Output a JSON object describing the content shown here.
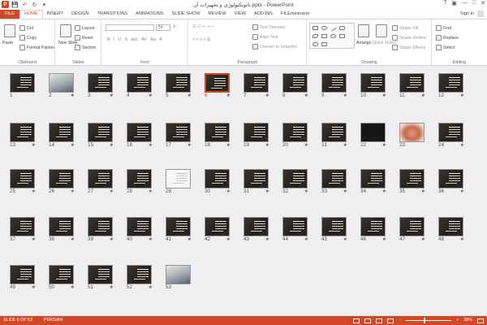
{
  "window": {
    "title": "نانوتکنولوژی و تجهیزات آن.pptx - PowerPoint",
    "controls": [
      "?",
      "▣",
      "—",
      "□",
      "✕"
    ]
  },
  "quick_access": {
    "logo": "P",
    "save": "💾",
    "undo": "↶",
    "redo": "↻",
    "customize": "▾"
  },
  "tabs": [
    {
      "label": "FILE",
      "kind": "file"
    },
    {
      "label": "HOME",
      "kind": "active"
    },
    {
      "label": "INSERT",
      "kind": ""
    },
    {
      "label": "DESIGN",
      "kind": ""
    },
    {
      "label": "TRANSITIONS",
      "kind": ""
    },
    {
      "label": "ANIMATIONS",
      "kind": ""
    },
    {
      "label": "SLIDE SHOW",
      "kind": ""
    },
    {
      "label": "REVIEW",
      "kind": ""
    },
    {
      "label": "VIEW",
      "kind": ""
    },
    {
      "label": "ADD-INS",
      "kind": ""
    },
    {
      "label": "FILEminimizer",
      "kind": ""
    }
  ],
  "account": {
    "sign_in": "Sign in"
  },
  "ribbon": {
    "clipboard": {
      "paste": "Paste",
      "cut": "Cut",
      "copy": "Copy",
      "format_painter": "Format Painter",
      "label": "Clipboard"
    },
    "slides": {
      "new_slide": "New Slide",
      "layout": "Layout",
      "reset": "Reset",
      "section": "Section",
      "label": "Slides"
    },
    "font": {
      "size": "54",
      "label": "Font",
      "format_row": [
        "B",
        "I",
        "U",
        "S",
        "abc",
        "AV",
        "Aa",
        "A"
      ]
    },
    "paragraph": {
      "text_direction": "Text Direction",
      "align_text": "Align Text",
      "convert_smartart": "Convert to SmartArt",
      "label": "Paragraph"
    },
    "drawing": {
      "arrange": "Arrange",
      "quick_styles": "Quick Styles",
      "shape_fill": "Shape Fill",
      "shape_outline": "Shape Outline",
      "shape_effects": "Shape Effects",
      "label": "Drawing"
    },
    "editing": {
      "find": "Find",
      "replace": "Replace",
      "select": "Select",
      "label": "Editing"
    }
  },
  "sorter": {
    "selected": "6",
    "slides": [
      {
        "n": "1",
        "star": "",
        "kind": "normal"
      },
      {
        "n": "2",
        "star": "★",
        "kind": "photo"
      },
      {
        "n": "3",
        "star": "★",
        "kind": "normal"
      },
      {
        "n": "4",
        "star": "★",
        "kind": "normal"
      },
      {
        "n": "5",
        "star": "★",
        "kind": "normal"
      },
      {
        "n": "6",
        "star": "★",
        "kind": "normal"
      },
      {
        "n": "7",
        "star": "★",
        "kind": "normal"
      },
      {
        "n": "8",
        "star": "★",
        "kind": "normal"
      },
      {
        "n": "9",
        "star": "★",
        "kind": "normal"
      },
      {
        "n": "10",
        "star": "★",
        "kind": "normal"
      },
      {
        "n": "11",
        "star": "★",
        "kind": "normal"
      },
      {
        "n": "12",
        "star": "★",
        "kind": "normal"
      },
      {
        "n": "13",
        "star": "★",
        "kind": "normal"
      },
      {
        "n": "14",
        "star": "★",
        "kind": "normal"
      },
      {
        "n": "15",
        "star": "★",
        "kind": "normal"
      },
      {
        "n": "16",
        "star": "★",
        "kind": "normal"
      },
      {
        "n": "17",
        "star": "★",
        "kind": "normal"
      },
      {
        "n": "18",
        "star": "★",
        "kind": "normal"
      },
      {
        "n": "19",
        "star": "★",
        "kind": "normal"
      },
      {
        "n": "20",
        "star": "★",
        "kind": "normal"
      },
      {
        "n": "21",
        "star": "★",
        "kind": "normal"
      },
      {
        "n": "22",
        "star": "★",
        "kind": "dark"
      },
      {
        "n": "23",
        "star": "",
        "kind": "face"
      },
      {
        "n": "24",
        "star": "★",
        "kind": "normal"
      },
      {
        "n": "25",
        "star": "★",
        "kind": "normal"
      },
      {
        "n": "26",
        "star": "★",
        "kind": "normal"
      },
      {
        "n": "27",
        "star": "★",
        "kind": "normal"
      },
      {
        "n": "28",
        "star": "★",
        "kind": "normal"
      },
      {
        "n": "29",
        "star": "",
        "kind": "light"
      },
      {
        "n": "30",
        "star": "★",
        "kind": "normal"
      },
      {
        "n": "31",
        "star": "★",
        "kind": "normal"
      },
      {
        "n": "32",
        "star": "★",
        "kind": "normal"
      },
      {
        "n": "33",
        "star": "★",
        "kind": "normal"
      },
      {
        "n": "34",
        "star": "★",
        "kind": "normal"
      },
      {
        "n": "35",
        "star": "★",
        "kind": "normal"
      },
      {
        "n": "36",
        "star": "★",
        "kind": "normal"
      },
      {
        "n": "37",
        "star": "★",
        "kind": "normal"
      },
      {
        "n": "38",
        "star": "★",
        "kind": "normal"
      },
      {
        "n": "39",
        "star": "★",
        "kind": "normal"
      },
      {
        "n": "40",
        "star": "★",
        "kind": "normal"
      },
      {
        "n": "41",
        "star": "★",
        "kind": "normal"
      },
      {
        "n": "42",
        "star": "★",
        "kind": "normal"
      },
      {
        "n": "43",
        "star": "★",
        "kind": "normal"
      },
      {
        "n": "44",
        "star": "★",
        "kind": "normal"
      },
      {
        "n": "45",
        "star": "★",
        "kind": "normal"
      },
      {
        "n": "46",
        "star": "★",
        "kind": "normal"
      },
      {
        "n": "47",
        "star": "★",
        "kind": "normal"
      },
      {
        "n": "48",
        "star": "★",
        "kind": "normal"
      },
      {
        "n": "49",
        "star": "★",
        "kind": "normal"
      },
      {
        "n": "50",
        "star": "★",
        "kind": "normal"
      },
      {
        "n": "51",
        "star": "★",
        "kind": "normal"
      },
      {
        "n": "52",
        "star": "★",
        "kind": "normal"
      },
      {
        "n": "53",
        "star": "",
        "kind": "photo"
      }
    ]
  },
  "status": {
    "slide_info": "SLIDE 6 OF 53",
    "language": "PERSIAN",
    "zoom_minus": "−",
    "zoom_plus": "+",
    "zoom": "38%",
    "zoom_fraction": 0.38
  },
  "colors": {
    "accent": "#d24726"
  }
}
